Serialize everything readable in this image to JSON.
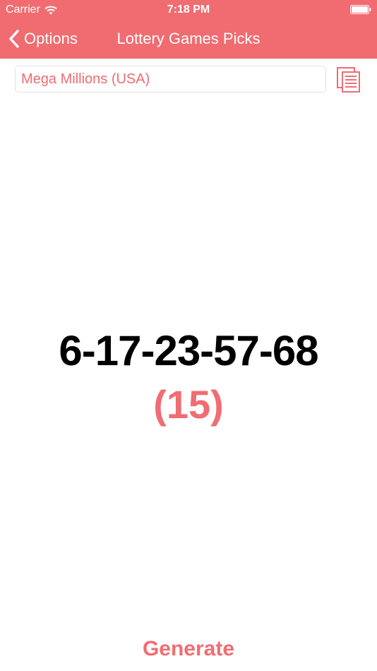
{
  "status_bar": {
    "carrier": "Carrier",
    "time": "7:18 PM"
  },
  "nav": {
    "back_label": "Options",
    "title": "Lottery Games Picks"
  },
  "game_picker": {
    "selected": "Mega Millions (USA)"
  },
  "result": {
    "numbers": "6-17-23-57-68",
    "bonus": "(15)"
  },
  "actions": {
    "generate_label": "Generate"
  },
  "colors": {
    "header": "#f06c70",
    "accent": "#ef6d73"
  },
  "icons": {
    "back": "chevron-left-icon",
    "wifi": "wifi-icon",
    "battery": "battery-icon",
    "list": "document-list-icon"
  }
}
